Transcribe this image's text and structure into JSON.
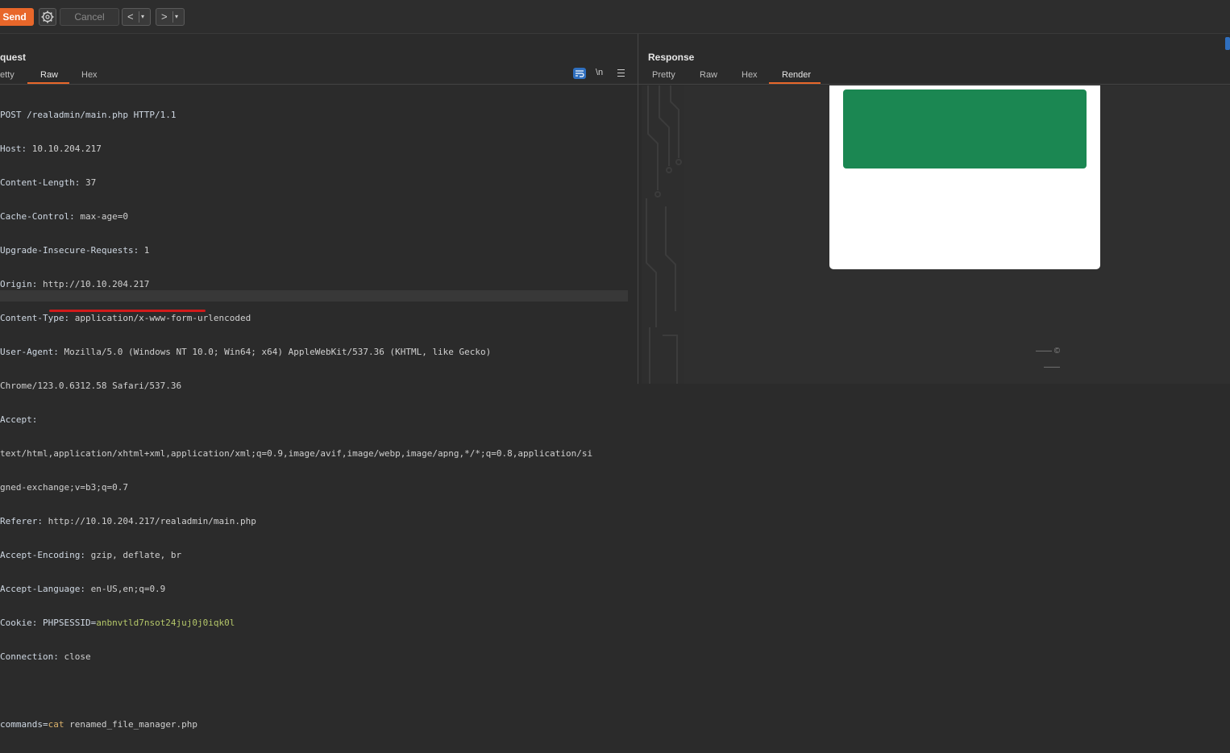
{
  "toolbar": {
    "send_label": "Send",
    "cancel_label": "Cancel",
    "back_arrow": "<",
    "forward_arrow": ">",
    "dropdown_glyph": "▾"
  },
  "request": {
    "title": "quest",
    "tabs": [
      "etty",
      "Raw",
      "Hex"
    ],
    "active_tab": "Raw",
    "tools": {
      "newline_label": "\\n"
    },
    "lines": [
      {
        "k": "POST /realadmin/main.php HTTP/1.1",
        "v": ""
      },
      {
        "k": "Host:",
        "v": " 10.10.204.217"
      },
      {
        "k": "Content-Length:",
        "v": " 37"
      },
      {
        "k": "Cache-Control:",
        "v": " max-age=0"
      },
      {
        "k": "Upgrade-Insecure-Requests:",
        "v": " 1"
      },
      {
        "k": "Origin:",
        "v": " http://10.10.204.217"
      },
      {
        "k": "Content-Type:",
        "v": " application/x-www-form-urlencoded"
      },
      {
        "k": "User-Agent:",
        "v": " Mozilla/5.0 (Windows NT 10.0; Win64; x64) AppleWebKit/537.36 (KHTML, like Gecko)"
      },
      {
        "k": "",
        "v": "Chrome/123.0.6312.58 Safari/537.36"
      },
      {
        "k": "Accept:",
        "v": ""
      },
      {
        "k": "",
        "v": "text/html,application/xhtml+xml,application/xml;q=0.9,image/avif,image/webp,image/apng,*/*;q=0.8,application/si"
      },
      {
        "k": "",
        "v": "gned-exchange;v=b3;q=0.7"
      },
      {
        "k": "Referer:",
        "v": " http://10.10.204.217/realadmin/main.php"
      },
      {
        "k": "Accept-Encoding:",
        "v": " gzip, deflate, br"
      },
      {
        "k": "Accept-Language:",
        "v": " en-US,en;q=0.9"
      }
    ],
    "cookie": {
      "k": "Cookie:",
      "name": " PHPSESSID=",
      "value": "anbnvtld7nsot24juj0j0iqk0l"
    },
    "connection": {
      "k": "Connection:",
      "v": " close"
    },
    "body": {
      "param": "commands=",
      "value": "cat",
      "rest": " renamed_file_manager.php"
    }
  },
  "response": {
    "title": "Response",
    "tabs": [
      "Pretty",
      "Raw",
      "Hex",
      "Render"
    ],
    "active_tab": "Render",
    "footer_copyright": "—— ©",
    "footer_line": "——",
    "colors": {
      "card": "#ffffff",
      "button": "#1b8752"
    }
  },
  "colors": {
    "accent": "#e8672a",
    "highlight_blue": "#2f6fbf",
    "underline_red": "#d21a1a"
  }
}
